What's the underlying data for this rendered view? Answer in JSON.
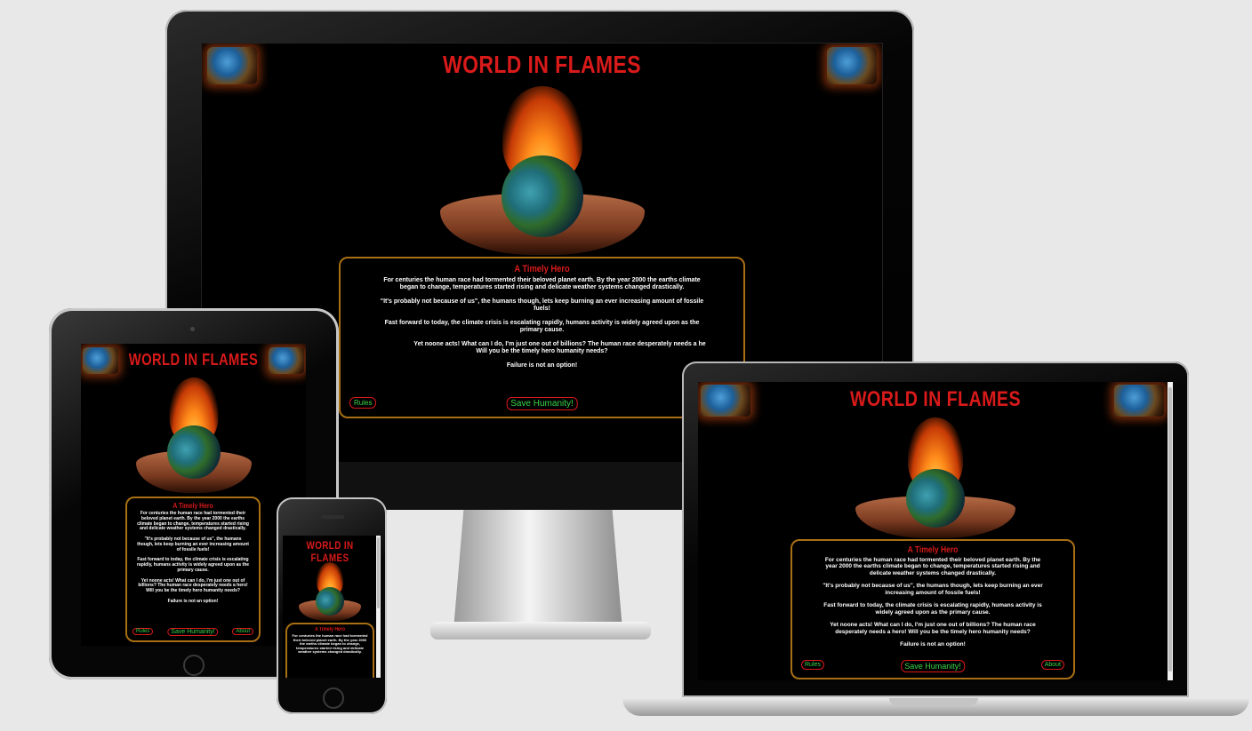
{
  "site": {
    "title": "WORLD IN FLAMES",
    "box_heading": "A Timely Hero",
    "paragraphs": [
      "For centuries the human race had tormented their beloved planet earth. By the year 2000 the earths climate began to change, temperatures started rising and delicate weather systems changed drastically.",
      "\"It's probably not because of us\", the humans though, lets keep burning an ever increasing amount of fossile fuels!",
      "Fast forward to today, the climate crisis is escalating rapidly, humans activity is widely agreed upon as the primary cause.",
      "Yet noone acts! What can I do, I'm just one out of billions? The human race desperately needs a hero! Will you be the timely hero humanity needs?",
      "Failure is not an option!"
    ],
    "monitor_paragraph_4": "Yet noone acts! What can I do, I'm just one out of billions? The human race desperately needs a he",
    "monitor_paragraph_4b": "Will you be the timely hero humanity needs?",
    "rules_label": "Rules",
    "save_label": "Save Humanity!",
    "about_label": "About"
  },
  "colors": {
    "page_bg": "#e8e8e8",
    "title_red": "#d91a1a",
    "button_text_green": "#3ad44a",
    "box_border_gold": "#a86f14",
    "screen_bg": "#000000"
  },
  "icons": [
    "globe-icon-left",
    "globe-icon-right",
    "burning-earth-hero-image"
  ]
}
